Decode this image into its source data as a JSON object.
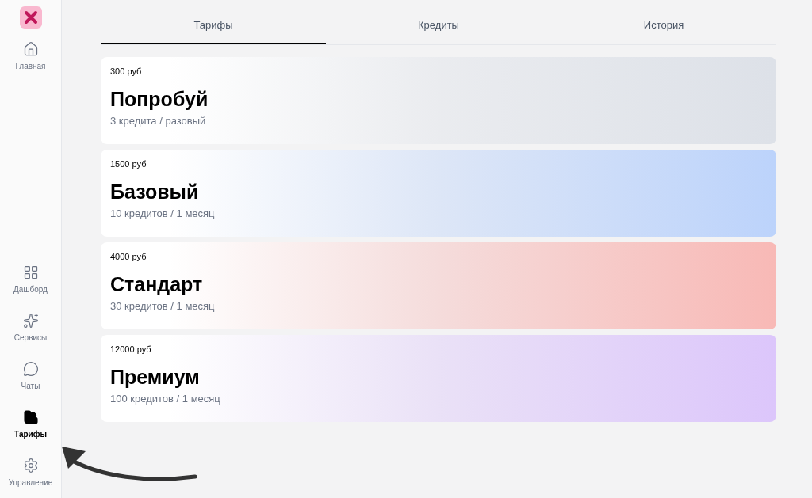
{
  "sidebar": {
    "top_items": [
      {
        "label": "Главная",
        "selected": false
      }
    ],
    "bottom_items": [
      {
        "label": "Дашборд",
        "selected": false
      },
      {
        "label": "Сервисы",
        "selected": false
      },
      {
        "label": "Чаты",
        "selected": false
      },
      {
        "label": "Тарифы",
        "selected": true
      },
      {
        "label": "Управление",
        "selected": false
      }
    ]
  },
  "tabs": [
    {
      "label": "Тарифы",
      "selected": true
    },
    {
      "label": "Кредиты",
      "selected": false
    },
    {
      "label": "История",
      "selected": false
    }
  ],
  "plans": [
    {
      "price": "300 руб",
      "name": "Попробуй",
      "details": "3 кредита / разовый",
      "color": "#dde1e8"
    },
    {
      "price": "1500 руб",
      "name": "Базовый",
      "details": "10 кредитов / 1 месяц",
      "color": "#bcd3fb"
    },
    {
      "price": "4000 руб",
      "name": "Стандарт",
      "details": "30 кредитов / 1 месяц",
      "color": "#f8b9b6"
    },
    {
      "price": "12000 руб",
      "name": "Премиум",
      "details": "100 кредитов / 1 месяц",
      "color": "#dcc6fb"
    }
  ]
}
